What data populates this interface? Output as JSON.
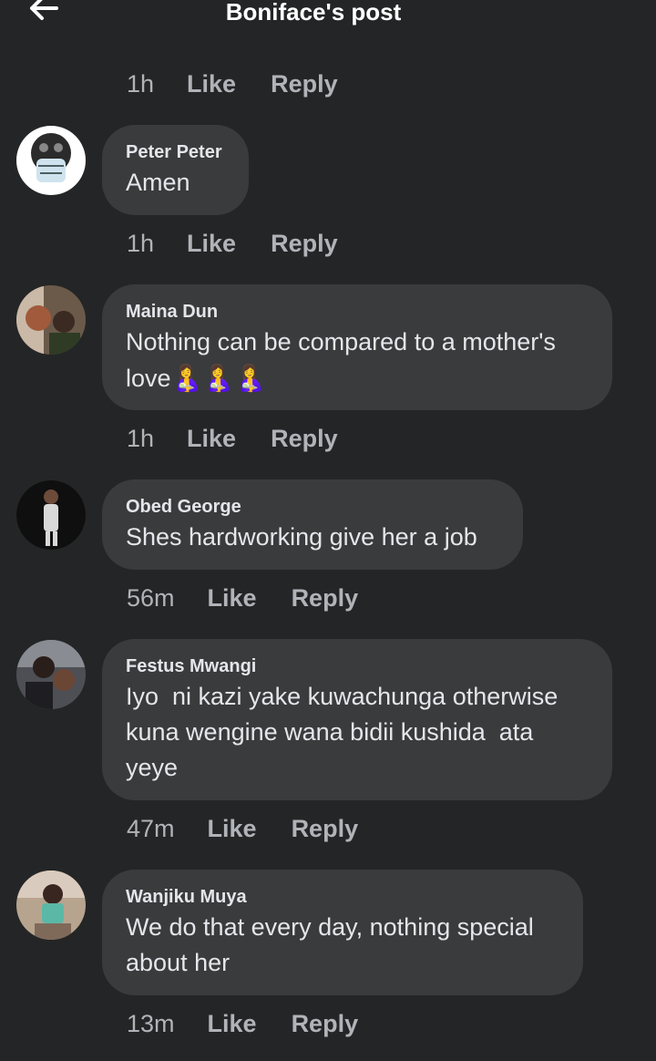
{
  "header": {
    "title": "Boniface's post",
    "back_icon": "arrow-left-icon"
  },
  "colors": {
    "background": "#242526",
    "bubble": "#3a3b3c",
    "muted": "#b0b3b8",
    "text": "#e4e6eb"
  },
  "top_actions": {
    "time": "1h",
    "like": "Like",
    "reply": "Reply"
  },
  "comments": [
    {
      "author": "Peter Peter",
      "text": "Amen",
      "time": "1h",
      "like": "Like",
      "reply": "Reply"
    },
    {
      "author": "Maina Dun",
      "text": "Nothing can be compared to a mother's love",
      "emoji": "🤱🤱🤱",
      "time": "1h",
      "like": "Like",
      "reply": "Reply"
    },
    {
      "author": "Obed George",
      "text": "Shes hardworking give her a job",
      "time": "56m",
      "like": "Like",
      "reply": "Reply"
    },
    {
      "author": "Festus Mwangi",
      "text": "Iyo  ni kazi yake kuwachunga otherwise kuna wengine wana bidii kushida  ata yeye",
      "time": "47m",
      "like": "Like",
      "reply": "Reply"
    },
    {
      "author": "Wanjiku Muya",
      "text": "We do that every day, nothing special about her",
      "time": "13m",
      "like": "Like",
      "reply": "Reply"
    }
  ]
}
